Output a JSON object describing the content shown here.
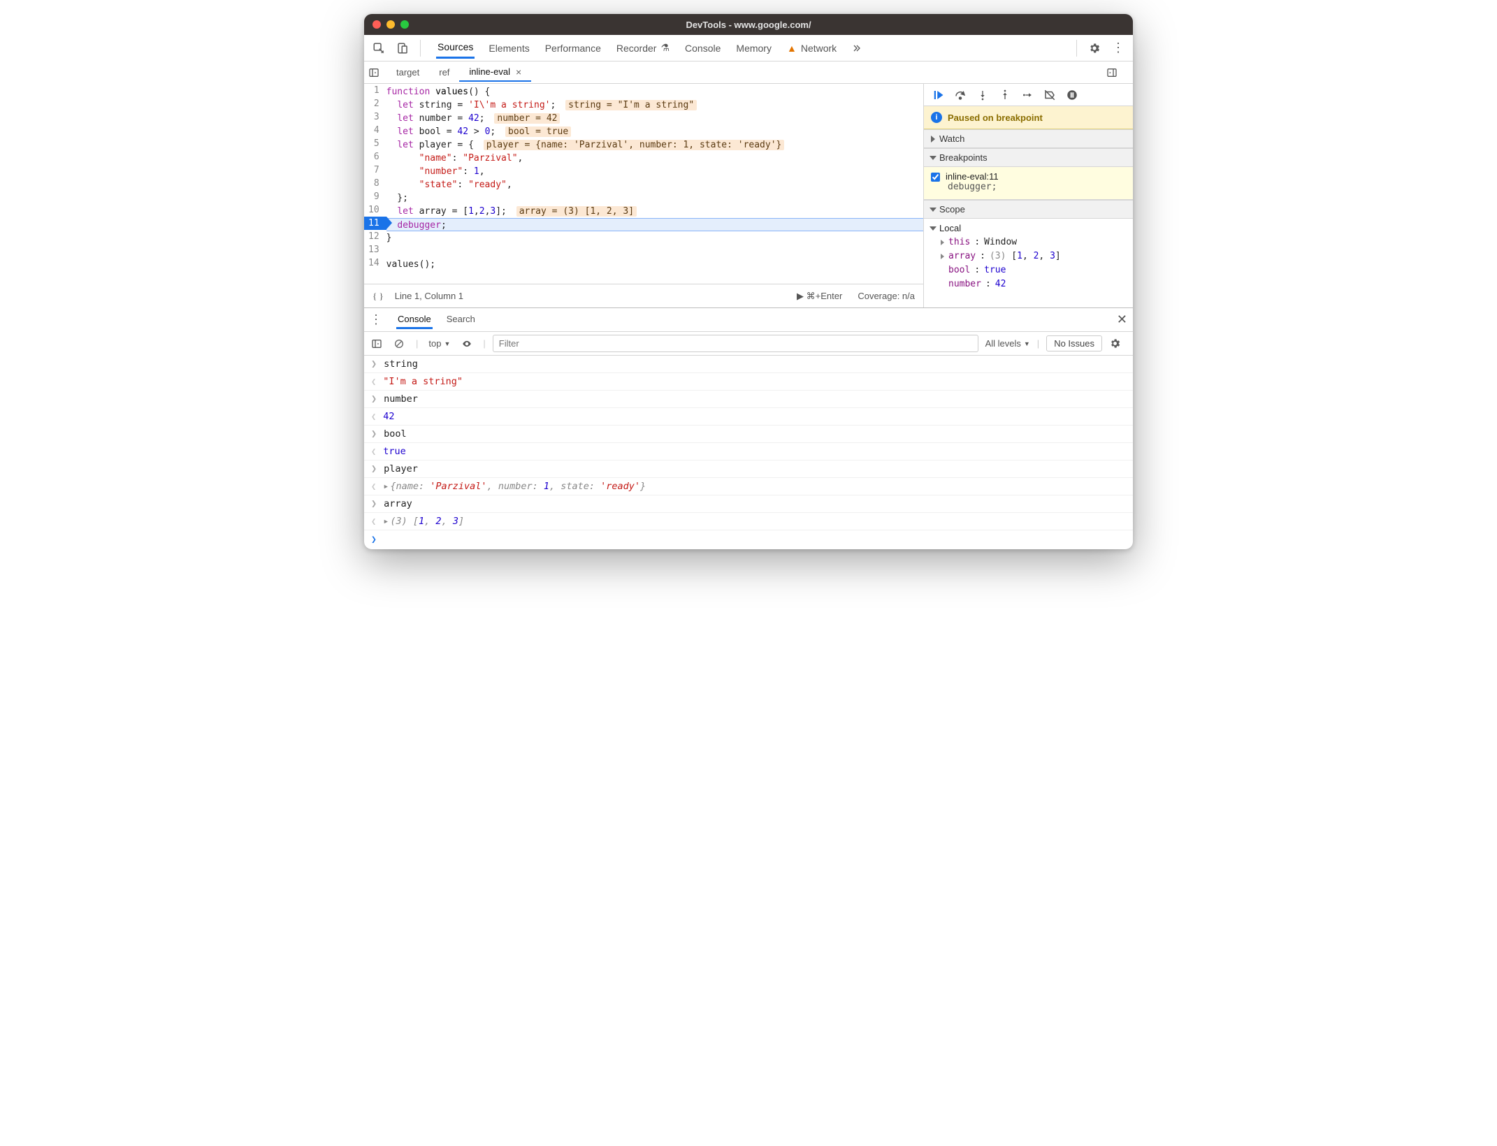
{
  "titlebar": {
    "title": "DevTools - www.google.com/"
  },
  "tabs": [
    "Sources",
    "Elements",
    "Performance",
    "Recorder",
    "Console",
    "Memory",
    "Network"
  ],
  "tabs_active": "Sources",
  "tabs_warn_index": 6,
  "src_tabs": {
    "items": [
      "target",
      "ref",
      "inline-eval"
    ],
    "active": "inline-eval"
  },
  "code": {
    "lines": [
      {
        "n": 1,
        "html": "<span class='kw'>function</span> <span class='fn'>values</span>() {"
      },
      {
        "n": 2,
        "html": "  <span class='kw'>let</span> string = <span class='str'>'I\\'m a string'</span>; <span class='hint'>string = \"I'm a string\"</span>"
      },
      {
        "n": 3,
        "html": "  <span class='kw'>let</span> number = <span class='num'>42</span>; <span class='hint'>number = 42</span>"
      },
      {
        "n": 4,
        "html": "  <span class='kw'>let</span> bool = <span class='num'>42</span> > <span class='num'>0</span>; <span class='hint'>bool = true</span>"
      },
      {
        "n": 5,
        "html": "  <span class='kw'>let</span> player = { <span class='hint'>player = {name: 'Parzival', number: 1, state: 'ready'}</span>"
      },
      {
        "n": 6,
        "html": "      <span class='prop'>\"name\"</span>: <span class='str'>\"Parzival\"</span>,"
      },
      {
        "n": 7,
        "html": "      <span class='prop'>\"number\"</span>: <span class='num'>1</span>,"
      },
      {
        "n": 8,
        "html": "      <span class='prop'>\"state\"</span>: <span class='str'>\"ready\"</span>,"
      },
      {
        "n": 9,
        "html": "  };"
      },
      {
        "n": 10,
        "html": "  <span class='kw'>let</span> array = [<span class='num'>1</span>,<span class='num'>2</span>,<span class='num'>3</span>]; <span class='hint'>array = (3) [1, 2, 3]</span>"
      },
      {
        "n": 11,
        "html": "  <span class='kw'>debugger</span>;",
        "exec": true
      },
      {
        "n": 12,
        "html": "}"
      },
      {
        "n": 13,
        "html": ""
      },
      {
        "n": 14,
        "html": "values();"
      }
    ]
  },
  "src_footer": {
    "pos": "Line 1, Column 1",
    "run": "⌘+Enter",
    "coverage": "Coverage: n/a"
  },
  "debugger": {
    "paused": "Paused on breakpoint",
    "watch": "Watch",
    "breakpoints_h": "Breakpoints",
    "bp": {
      "label": "inline-eval:11",
      "code": "debugger;"
    },
    "scope_h": "Scope",
    "scope_local": "Local",
    "scope_rows": [
      {
        "tri": true,
        "k": "this",
        "v": "Window",
        "cls": "v-obj"
      },
      {
        "tri": true,
        "k": "array",
        "v": "(3) [1, 2, 3]",
        "cls": "v-obj",
        "brackets": true
      },
      {
        "tri": false,
        "k": "bool",
        "v": "true",
        "cls": "v-bool"
      },
      {
        "tri": false,
        "k": "number",
        "v": "42",
        "cls": "v-num"
      }
    ]
  },
  "drawer": {
    "tabs": [
      "Console",
      "Search"
    ],
    "active": "Console",
    "context": "top",
    "filter_placeholder": "Filter",
    "levels": "All levels",
    "issues": "No Issues"
  },
  "console": [
    {
      "dir": "in",
      "text": "string"
    },
    {
      "dir": "out",
      "html": "<span class='cstr'>\"I'm a string\"</span>"
    },
    {
      "dir": "in",
      "text": "number"
    },
    {
      "dir": "out",
      "html": "<span class='cnum'>42</span>"
    },
    {
      "dir": "in",
      "text": "bool"
    },
    {
      "dir": "out",
      "html": "<span class='cbool'>true</span>"
    },
    {
      "dir": "in",
      "text": "player"
    },
    {
      "dir": "out",
      "html": "<span class='chev' style='color:#888;margin-right:2px;'>▸</span><span class='cobj'>{name: <span class='v'>'Parzival'</span>, number: <span class='cnum' style='font-style:italic'>1</span>, state: <span class='v'>'ready'</span>}</span>"
    },
    {
      "dir": "in",
      "text": "array"
    },
    {
      "dir": "out",
      "html": "<span class='chev' style='color:#888;margin-right:2px;'>▸</span><span class='carr'>(3) [<span class='n'>1</span>, <span class='n'>2</span>, <span class='n'>3</span>]</span>"
    }
  ]
}
